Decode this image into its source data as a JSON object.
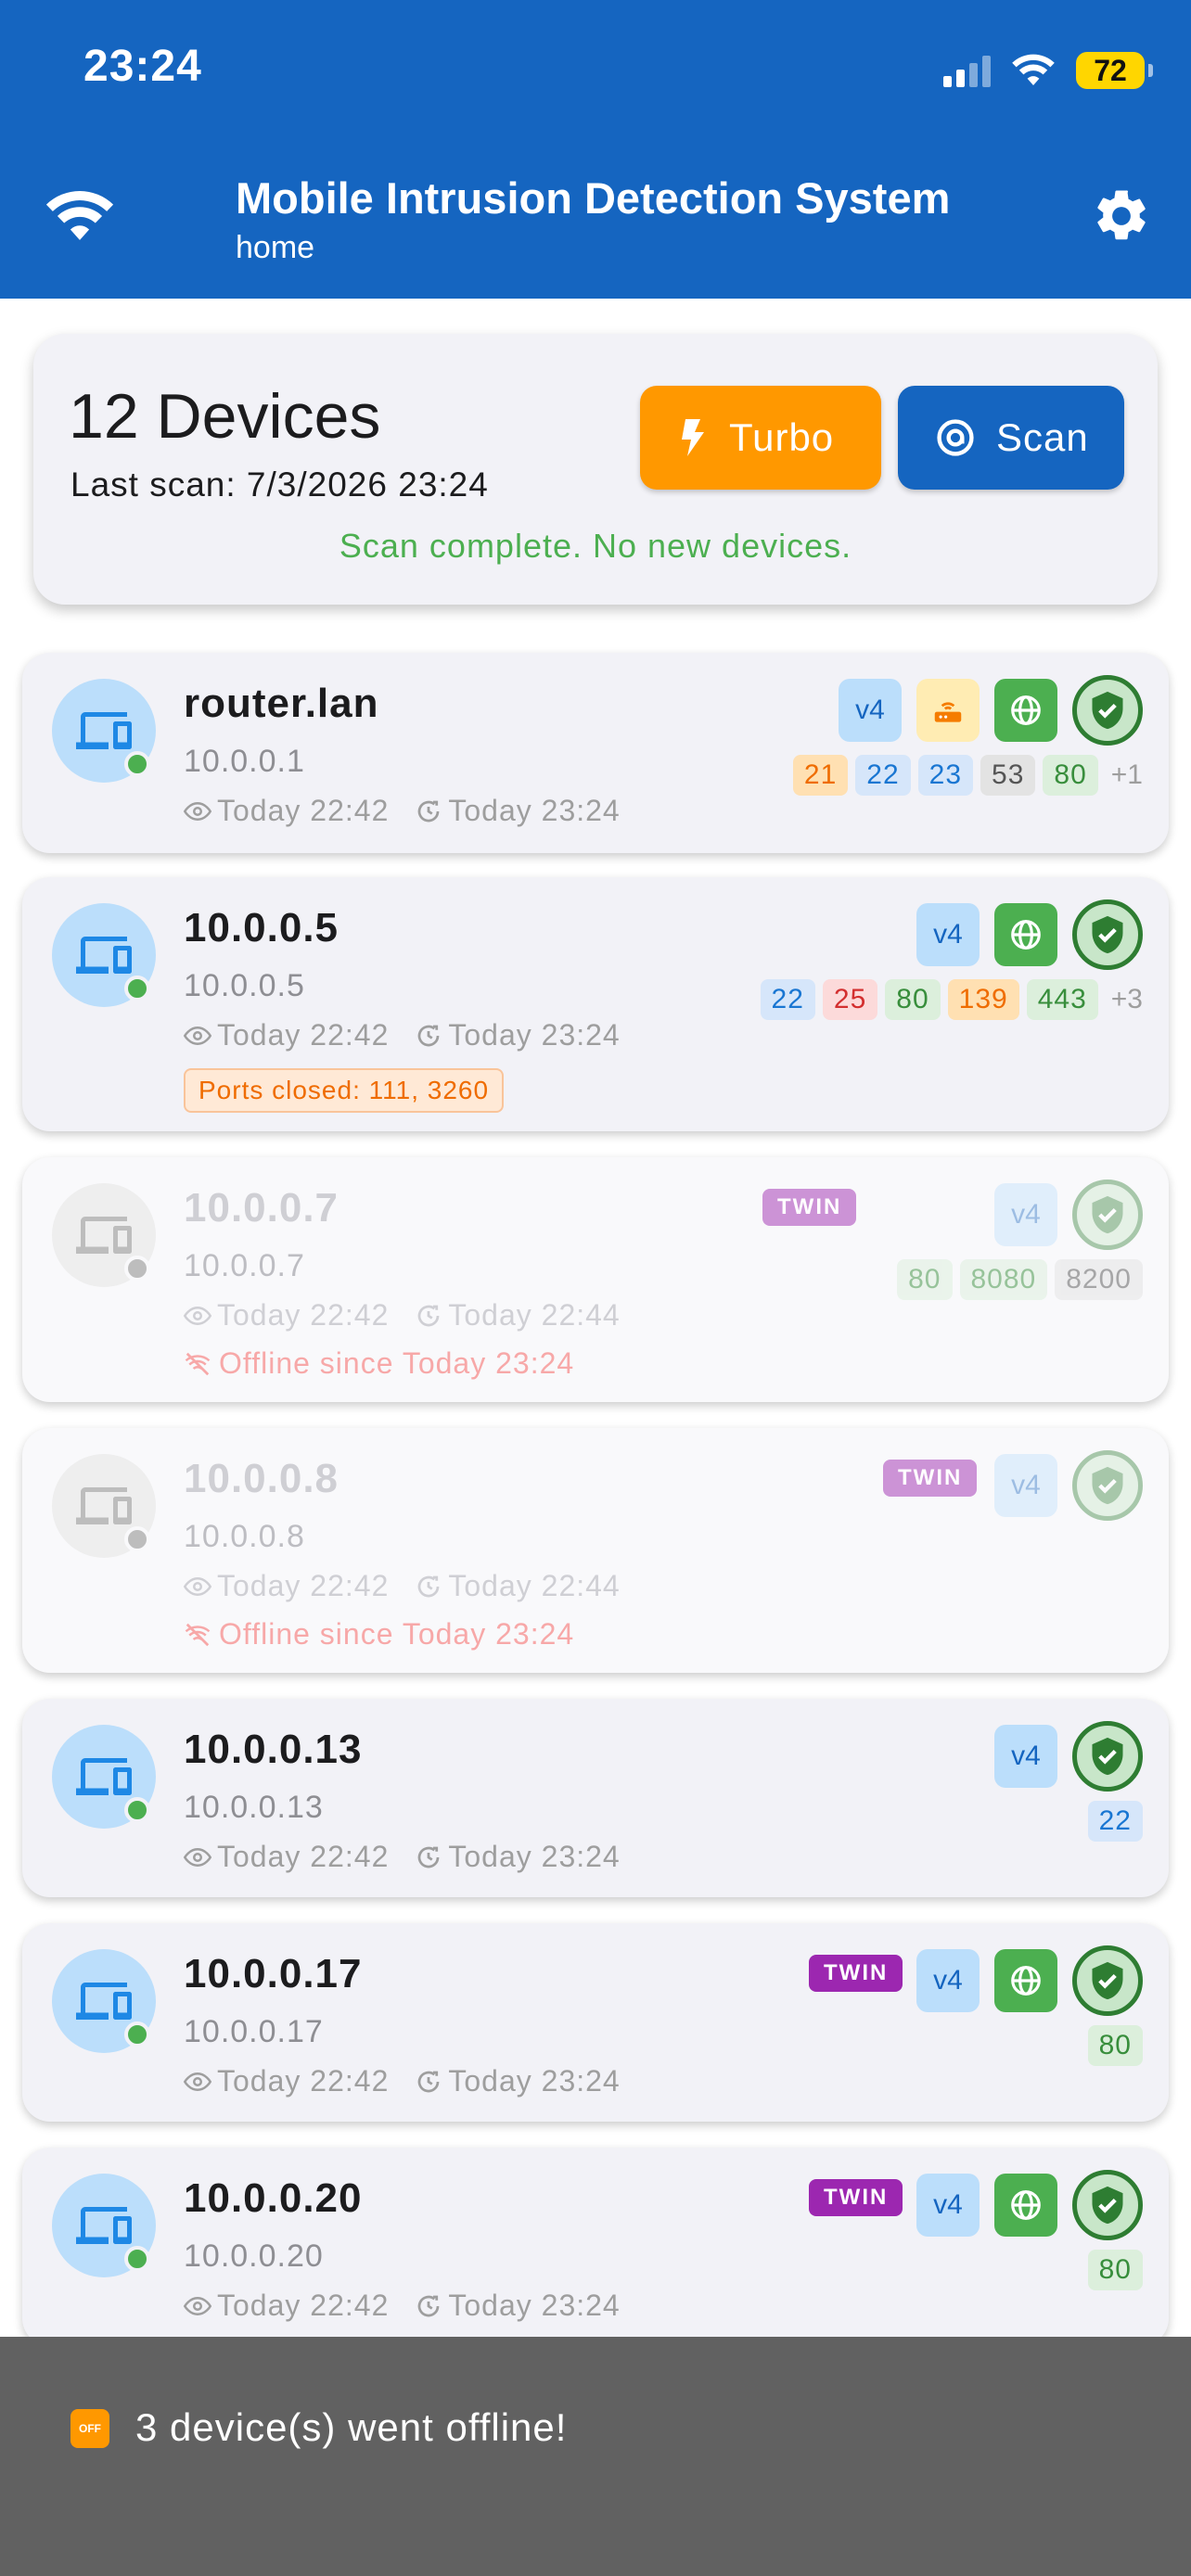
{
  "status_bar": {
    "time": "23:24",
    "battery": "72"
  },
  "app_bar": {
    "title": "Mobile Intrusion Detection System",
    "subtitle": "home"
  },
  "summary": {
    "device_count": "12 Devices",
    "last_scan": "Last scan: 7/3/2026 23:24",
    "message": "Scan complete. No new devices.",
    "turbo_label": "Turbo",
    "scan_label": "Scan"
  },
  "devices": [
    {
      "name": "router.lan",
      "ip": "10.0.0.1",
      "first_seen": "Today 22:42",
      "last_seen": "Today 23:24",
      "ipver": "v4",
      "ports": [
        "21",
        "22",
        "23",
        "53",
        "80"
      ],
      "more": "+1",
      "online": true
    },
    {
      "name": "10.0.0.5",
      "ip": "10.0.0.5",
      "first_seen": "Today 22:42",
      "last_seen": "Today 23:24",
      "ipver": "v4",
      "ports": [
        "22",
        "25",
        "80",
        "139",
        "443"
      ],
      "more": "+3",
      "note": "Ports closed: 111, 3260",
      "online": true
    },
    {
      "name": "10.0.0.7",
      "ip": "10.0.0.7",
      "first_seen": "Today 22:42",
      "last_seen": "Today 22:44",
      "ipver": "v4",
      "twin": "TWIN",
      "ports": [
        "80",
        "8080",
        "8200"
      ],
      "offline_note": "Offline since Today 23:24",
      "online": false
    },
    {
      "name": "10.0.0.8",
      "ip": "10.0.0.8",
      "first_seen": "Today 22:42",
      "last_seen": "Today 22:44",
      "ipver": "v4",
      "twin": "TWIN",
      "offline_note": "Offline since Today 23:24",
      "online": false
    },
    {
      "name": "10.0.0.13",
      "ip": "10.0.0.13",
      "first_seen": "Today 22:42",
      "last_seen": "Today 23:24",
      "ipver": "v4",
      "ports": [
        "22"
      ],
      "online": true
    },
    {
      "name": "10.0.0.17",
      "ip": "10.0.0.17",
      "first_seen": "Today 22:42",
      "last_seen": "Today 23:24",
      "ipver": "v4",
      "twin": "TWIN",
      "ports": [
        "80"
      ],
      "online": true
    },
    {
      "name": "10.0.0.20",
      "ip": "10.0.0.20",
      "first_seen": "Today 22:42",
      "last_seen": "Today 23:24",
      "ipver": "v4",
      "twin": "TWIN",
      "ports": [
        "80"
      ],
      "online": true
    }
  ],
  "snackbar": {
    "icon_text": "OFF",
    "message": "3 device(s) went offline!"
  },
  "colors": {
    "primary": "#1565c0",
    "turbo": "#ff9800",
    "success": "#4caf50",
    "twin": "#9c27b0",
    "offline_text": "#f7a8a8"
  }
}
